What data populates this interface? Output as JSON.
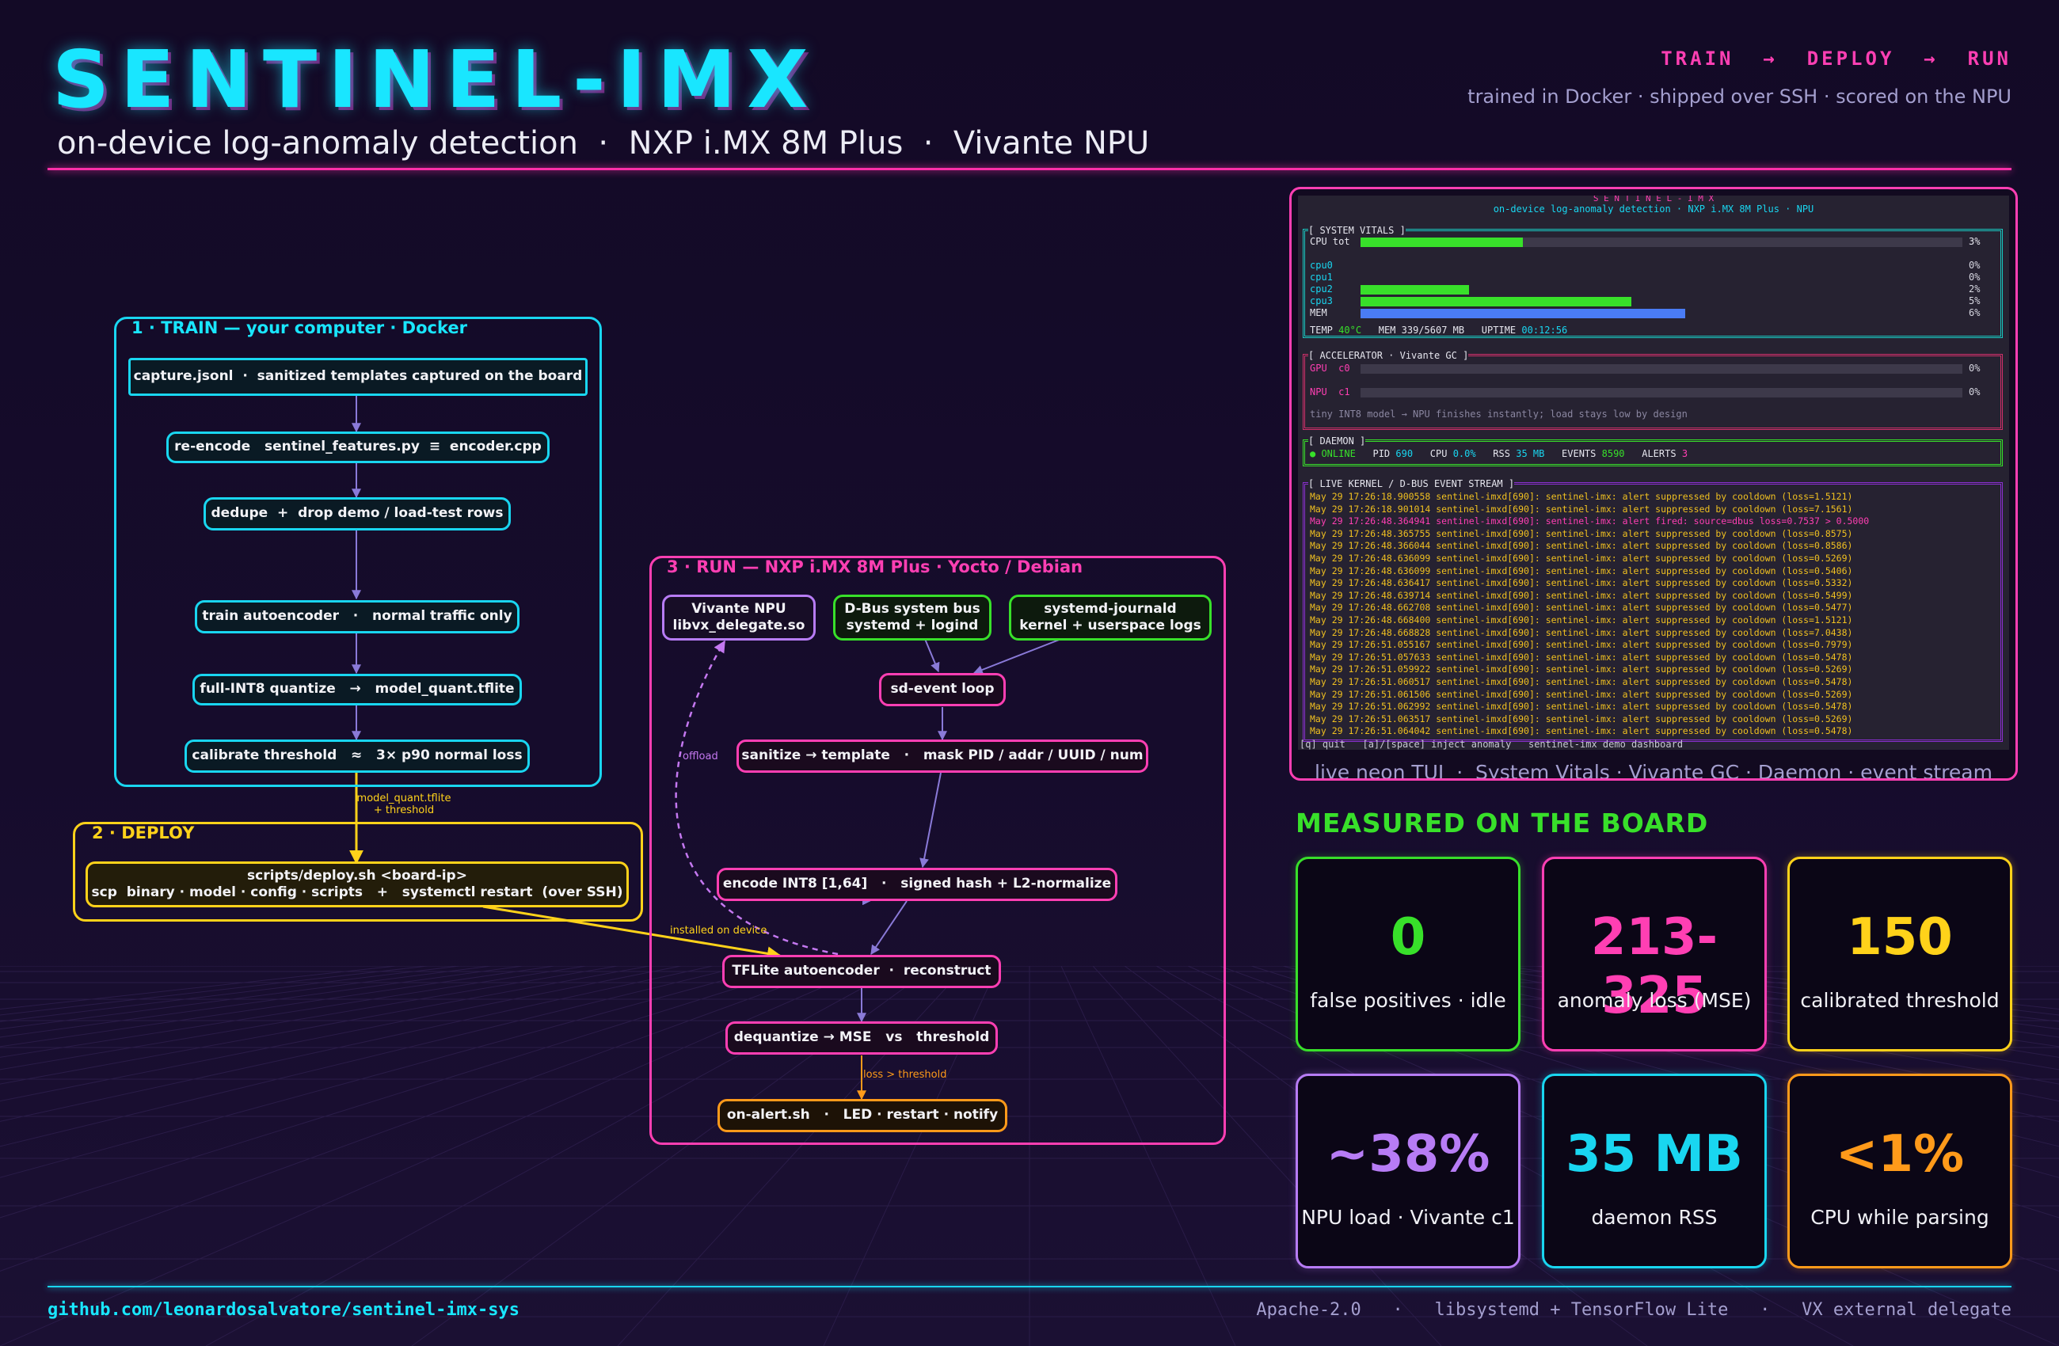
{
  "header": {
    "title": "SENTINEL-IMX",
    "subtitle": "on-device log-anomaly detection  ·  NXP i.MX 8M Plus  ·  Vivante NPU",
    "pipeline": "TRAIN  →  DEPLOY  →  RUN",
    "tagline": "trained in Docker · shipped over SSH · scored on the NPU"
  },
  "colors": {
    "cyan": "#19d6f0",
    "pink": "#ff3fb3",
    "green": "#38e02a",
    "yellow": "#ffd21a",
    "purple": "#b77cf5",
    "orange": "#ff9a1a"
  },
  "diagram": {
    "train": {
      "label": "1 · TRAIN — your computer · Docker",
      "nodes": [
        "capture.jsonl  ·  sanitized templates captured on the board",
        "re-encode   sentinel_features.py  ≡  encoder.cpp",
        "dedupe  +  drop demo / load-test rows",
        "train autoencoder   ·   normal traffic only",
        "full-INT8 quantize   →   model_quant.tflite",
        "calibrate threshold   ≈   3× p90 normal loss"
      ]
    },
    "deploy": {
      "label": "2 · DEPLOY",
      "node": "scripts/deploy.sh <board-ip>\nscp  binary · model · config · scripts   +   systemctl restart  (over SSH)"
    },
    "run": {
      "label": "3 · RUN — NXP i.MX 8M Plus · Yocto / Debian",
      "npu": "Vivante NPU\nlibvx_delegate.so",
      "dbus": "D-Bus system bus\nsystemd + logind",
      "journald": "systemd-journald\nkernel + userspace logs",
      "sdevent": "sd-event loop",
      "sanitize": "sanitize → template   ·   mask PID / addr / UUID / num",
      "encode": "encode INT8 [1,64]   ·   signed hash + L2-normalize",
      "tflite": "TFLite autoencoder  ·  reconstruct",
      "dequant": "dequantize → MSE   vs   threshold",
      "alert": "on-alert.sh   ·   LED · restart · notify"
    },
    "edges": {
      "model": "model_quant.tflite\n+ threshold",
      "installed": "installed on device",
      "offload": "offload",
      "loss": "loss > threshold"
    }
  },
  "tui": {
    "app_title": "S E N T I N E L - I M X",
    "app_subtitle": "on-device log-anomaly detection · NXP i.MX 8M Plus · NPU",
    "vitals": {
      "title": "[ SYSTEM VITALS ]",
      "cpu_tot_label": "CPU tot",
      "cpu_tot_value": "3%",
      "cpu_tot_level": 0.03,
      "cores": [
        {
          "label": "cpu0",
          "value": "0%",
          "level": 0.0
        },
        {
          "label": "cpu1",
          "value": "0%",
          "level": 0.0
        },
        {
          "label": "cpu2",
          "value": "2%",
          "level": 0.02
        },
        {
          "label": "cpu3",
          "value": "5%",
          "level": 0.05
        },
        {
          "label": "MEM",
          "value": "6%",
          "level": 0.06
        }
      ],
      "footer_temp_label": "TEMP",
      "footer_temp": "40°C",
      "footer_mem": "MEM 339/5607 MB",
      "footer_uptime_label": "UPTIME",
      "footer_uptime": "00:12:56"
    },
    "accelerator": {
      "title": "[ ACCELERATOR · Vivante GC ]",
      "gpu_label": "GPU  c0",
      "gpu_value": "0%",
      "npu_label": "NPU  c1",
      "npu_value": "0%",
      "note": "tiny INT8 model → NPU finishes instantly; load stays low by design"
    },
    "daemon": {
      "title": "[ DAEMON ]",
      "status": "● ONLINE",
      "pid_label": "PID",
      "pid": "690",
      "cpu_label": "CPU",
      "cpu": "0.0%",
      "rss_label": "RSS",
      "rss": "35 MB",
      "events_label": "EVENTS",
      "events": "8590",
      "alerts_label": "ALERTS",
      "alerts": "3"
    },
    "stream": {
      "title": "[ LIVE KERNEL / D-BUS EVENT STREAM ]",
      "lines": [
        "May 29 17:26:18.900558 sentinel-imxd[690]: sentinel-imx: alert suppressed by cooldown (loss=1.5121)",
        "May 29 17:26:18.901014 sentinel-imxd[690]: sentinel-imx: alert suppressed by cooldown (loss=7.1561)",
        "May 29 17:26:48.364941 sentinel-imxd[690]: sentinel-imx: alert fired: source=dbus loss=0.7537 > 0.5000",
        "May 29 17:26:48.365755 sentinel-imxd[690]: sentinel-imx: alert suppressed by cooldown (loss=0.8575)",
        "May 29 17:26:48.366044 sentinel-imxd[690]: sentinel-imx: alert suppressed by cooldown (loss=0.8586)",
        "May 29 17:26:48.636099 sentinel-imxd[690]: sentinel-imx: alert suppressed by cooldown (loss=0.5269)",
        "May 29 17:26:48.636099 sentinel-imxd[690]: sentinel-imx: alert suppressed by cooldown (loss=0.5406)",
        "May 29 17:26:48.636417 sentinel-imxd[690]: sentinel-imx: alert suppressed by cooldown (loss=0.5332)",
        "May 29 17:26:48.639714 sentinel-imxd[690]: sentinel-imx: alert suppressed by cooldown (loss=0.5499)",
        "May 29 17:26:48.662708 sentinel-imxd[690]: sentinel-imx: alert suppressed by cooldown (loss=0.5477)",
        "May 29 17:26:48.668400 sentinel-imxd[690]: sentinel-imx: alert suppressed by cooldown (loss=1.5121)",
        "May 29 17:26:48.668828 sentinel-imxd[690]: sentinel-imx: alert suppressed by cooldown (loss=7.0438)",
        "May 29 17:26:51.055167 sentinel-imxd[690]: sentinel-imx: alert suppressed by cooldown (loss=0.7979)",
        "May 29 17:26:51.057633 sentinel-imxd[690]: sentinel-imx: alert suppressed by cooldown (loss=0.5478)",
        "May 29 17:26:51.059922 sentinel-imxd[690]: sentinel-imx: alert suppressed by cooldown (loss=0.5269)",
        "May 29 17:26:51.060517 sentinel-imxd[690]: sentinel-imx: alert suppressed by cooldown (loss=0.5478)",
        "May 29 17:26:51.061506 sentinel-imxd[690]: sentinel-imx: alert suppressed by cooldown (loss=0.5269)",
        "May 29 17:26:51.062992 sentinel-imxd[690]: sentinel-imx: alert suppressed by cooldown (loss=0.5478)",
        "May 29 17:26:51.063517 sentinel-imxd[690]: sentinel-imx: alert suppressed by cooldown (loss=0.5269)",
        "May 29 17:26:51.064042 sentinel-imxd[690]: sentinel-imx: alert suppressed by cooldown (loss=0.5478)"
      ]
    },
    "keys": "[q] quit   [a]/[space] inject anomaly   sentinel-imx demo dashboard",
    "caption": "live neon TUI  ·  System Vitals · Vivante GC · Daemon · event stream"
  },
  "measured": {
    "title": "MEASURED ON THE BOARD",
    "cards": [
      {
        "value": "0",
        "label": "false positives · idle",
        "color": "#38e02a"
      },
      {
        "value": "213-325",
        "label": "anomaly loss (MSE)",
        "color": "#ff3fb3"
      },
      {
        "value": "150",
        "label": "calibrated threshold",
        "color": "#ffd21a"
      },
      {
        "value": "~38%",
        "label": "NPU load · Vivante c1",
        "color": "#b77cf5"
      },
      {
        "value": "35 MB",
        "label": "daemon RSS",
        "color": "#19d6f0"
      },
      {
        "value": "<1%",
        "label": "CPU while parsing",
        "color": "#ff9a1a"
      }
    ]
  },
  "footer": {
    "repo": "github.com/leonardosalvatore/sentinel-imx-sys",
    "meta": "Apache-2.0   ·   libsystemd + TensorFlow Lite   ·   VX external delegate"
  }
}
